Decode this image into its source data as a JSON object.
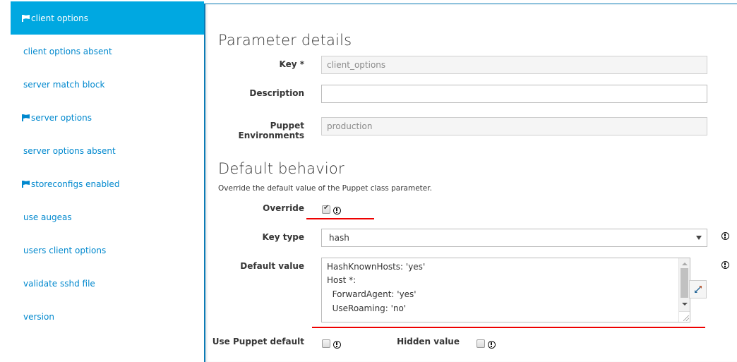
{
  "sidebar": {
    "items": [
      {
        "label": "client options",
        "flag": true,
        "active": true
      },
      {
        "label": "client options absent",
        "flag": false,
        "active": false
      },
      {
        "label": "server match block",
        "flag": false,
        "active": false
      },
      {
        "label": "server options",
        "flag": true,
        "active": false
      },
      {
        "label": "server options absent",
        "flag": false,
        "active": false
      },
      {
        "label": "storeconfigs enabled",
        "flag": true,
        "active": false
      },
      {
        "label": "use augeas",
        "flag": false,
        "active": false
      },
      {
        "label": "users client options",
        "flag": false,
        "active": false
      },
      {
        "label": "validate sshd file",
        "flag": false,
        "active": false
      },
      {
        "label": "version",
        "flag": false,
        "active": false
      }
    ]
  },
  "parameter_details": {
    "title": "Parameter details",
    "key_label": "Key *",
    "key_value": "client_options",
    "description_label": "Description",
    "description_value": "",
    "environments_label": "Puppet Environments",
    "environments_value": "production"
  },
  "default_behavior": {
    "title": "Default behavior",
    "help_text": "Override the default value of the Puppet class parameter.",
    "override_label": "Override",
    "override_checked": true,
    "key_type_label": "Key type",
    "key_type_value": "hash",
    "default_value_label": "Default value",
    "default_value_lines": [
      "HashKnownHosts: 'yes'",
      "Host *:",
      "  ForwardAgent: 'yes'",
      "  UseRoaming: 'no'"
    ],
    "use_puppet_default_label": "Use Puppet default",
    "use_puppet_default_checked": false,
    "hidden_value_label": "Hidden value",
    "hidden_value_checked": false
  },
  "colors": {
    "accent": "#00a8e1",
    "link": "#0088ce",
    "annotation_red": "#ee0000"
  }
}
